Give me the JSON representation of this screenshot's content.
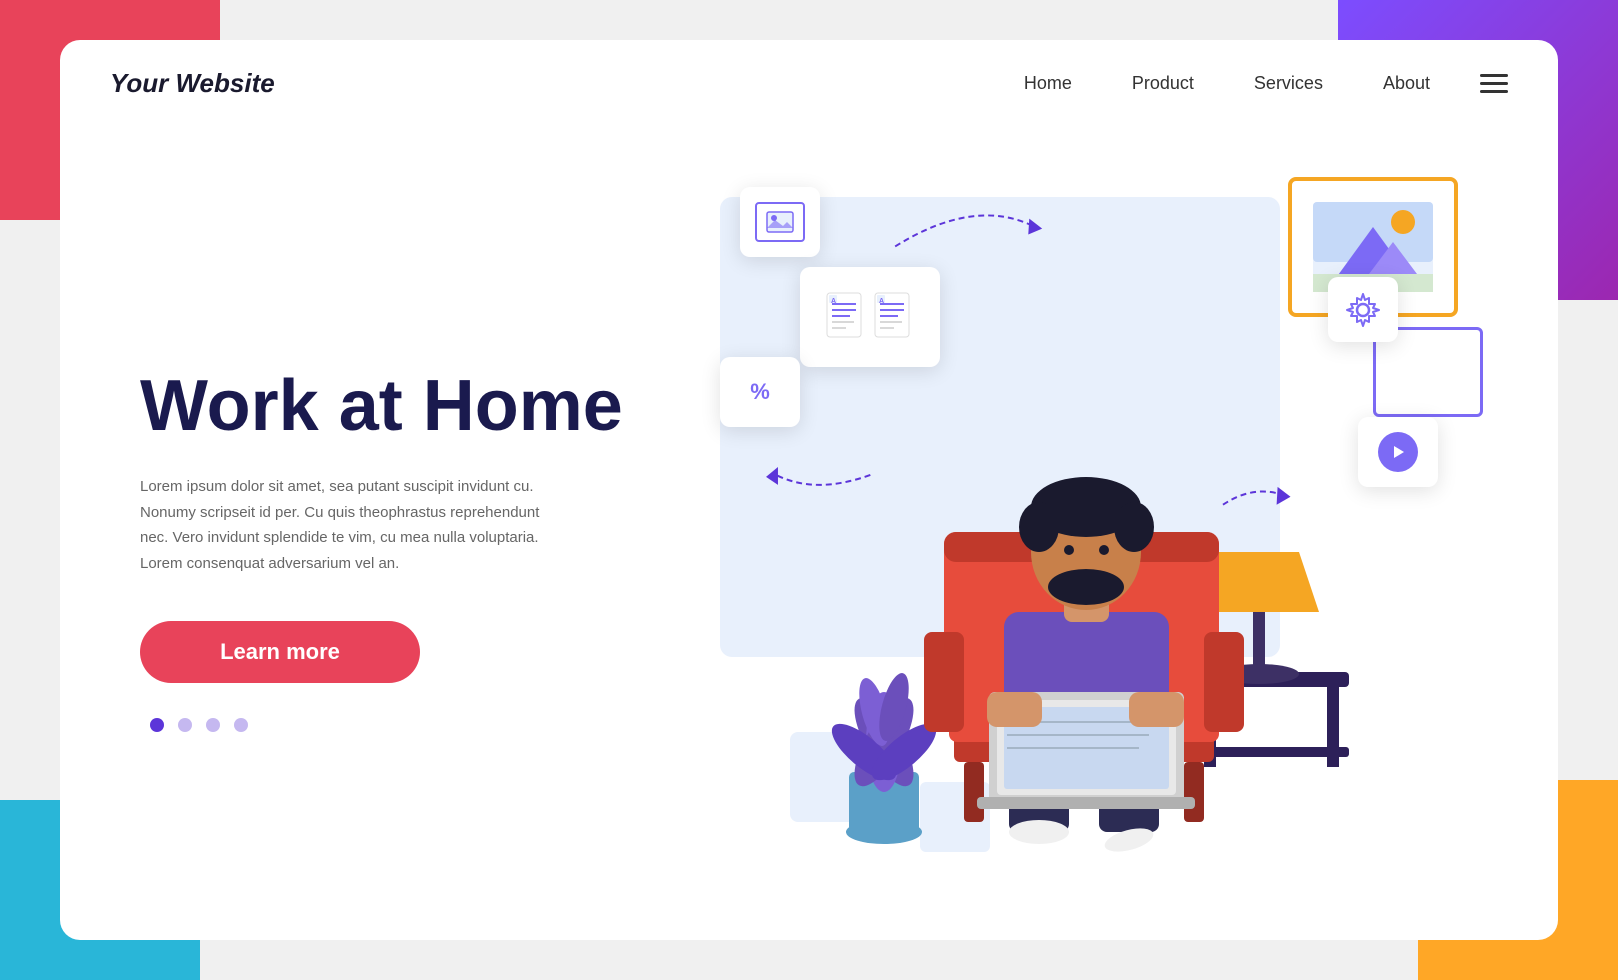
{
  "page": {
    "background_corners": {
      "tl_color": "#e8435a",
      "tr_color": "#7c4dff",
      "bl_color": "#29b6d8",
      "br_color": "#ffa726"
    }
  },
  "nav": {
    "logo": "Your Website",
    "links": [
      {
        "label": "Home",
        "id": "home"
      },
      {
        "label": "Product",
        "id": "product"
      },
      {
        "label": "Services",
        "id": "services"
      },
      {
        "label": "About",
        "id": "about"
      }
    ],
    "hamburger_label": "menu"
  },
  "hero": {
    "title": "Work at Home",
    "description": "Lorem ipsum dolor sit amet, sea putant suscipit invidunt cu. Nonumy scripseit id per. Cu quis theophrastus reprehendunt nec. Vero invidunt splendide te vim, cu mea nulla voluptaria. Lorem consenquat adversarium vel an.",
    "cta_label": "Learn more",
    "dots": [
      {
        "state": "active"
      },
      {
        "state": "inactive"
      },
      {
        "state": "inactive"
      },
      {
        "state": "inactive"
      }
    ]
  },
  "illustration": {
    "floating_cards": [
      {
        "type": "image",
        "label": "image-card"
      },
      {
        "type": "document",
        "label": "doc-card"
      },
      {
        "type": "percent",
        "value": "%",
        "label": "percent-card"
      },
      {
        "type": "gear",
        "label": "gear-card"
      },
      {
        "type": "play",
        "label": "play-card"
      }
    ]
  }
}
